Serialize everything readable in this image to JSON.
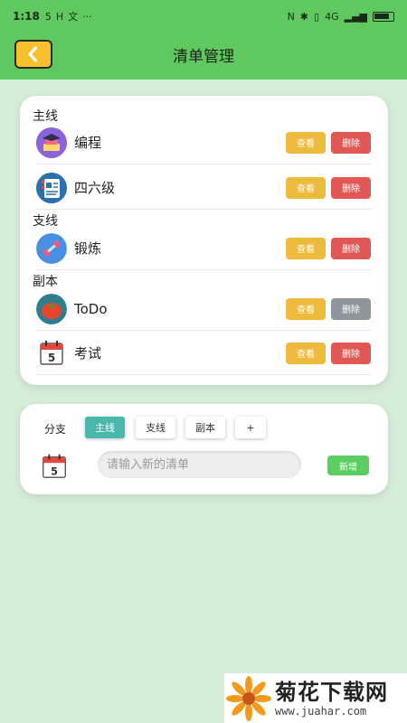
{
  "status_bar": {
    "time": "1:18",
    "left_icons": [
      "5",
      "H"
    ],
    "network": "4G",
    "colors": {
      "bg": "#5fc95f"
    }
  },
  "header": {
    "title": "清单管理"
  },
  "lists": {
    "sections": [
      {
        "label": "主线",
        "items": [
          {
            "name": "编程",
            "icon": "coding-icon",
            "view_label": "查看",
            "delete_label": "删除",
            "delete_enabled": true
          },
          {
            "name": "四六级",
            "icon": "notebook-icon",
            "view_label": "查看",
            "delete_label": "删除",
            "delete_enabled": true
          }
        ]
      },
      {
        "label": "支线",
        "items": [
          {
            "name": "锻炼",
            "icon": "dumbbell-icon",
            "view_label": "查看",
            "delete_label": "删除",
            "delete_enabled": true
          }
        ]
      },
      {
        "label": "副本",
        "items": [
          {
            "name": "ToDo",
            "icon": "tomato-icon",
            "view_label": "查看",
            "delete_label": "删除",
            "delete_enabled": false
          },
          {
            "name": "考试",
            "icon": "calendar-icon",
            "view_label": "查看",
            "delete_label": "删除",
            "delete_enabled": true
          }
        ]
      }
    ]
  },
  "add_panel": {
    "branch_label": "分支",
    "tabs": [
      {
        "label": "主线",
        "active": true
      },
      {
        "label": "支线",
        "active": false
      },
      {
        "label": "副本",
        "active": false
      },
      {
        "label": "+",
        "active": false
      }
    ],
    "input_placeholder": "请输入新的清单",
    "add_button": "新增"
  },
  "watermark": {
    "title": "菊花下载网",
    "url": "www.juahar.com"
  },
  "colors": {
    "accent_green": "#5fc95f",
    "page_bg": "#d6edd8",
    "view_btn": "#eeba3b",
    "delete_btn": "#df5854",
    "delete_disabled": "#8e969c",
    "tab_active": "#48b8ad",
    "add_btn": "#5ccd63",
    "back_btn": "#f5c02c"
  }
}
